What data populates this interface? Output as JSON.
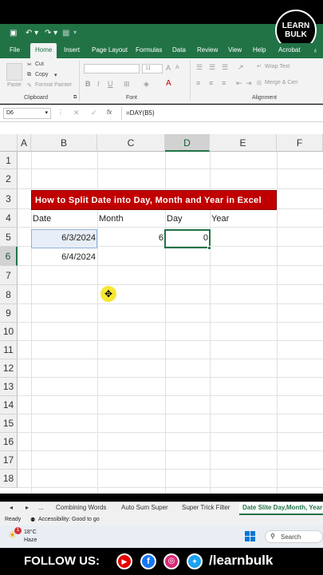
{
  "qat": {
    "save_icon": "save-icon",
    "undo_icon": "undo-icon",
    "redo_icon": "redo-icon"
  },
  "logo": {
    "line1": "LEARN",
    "line2": "BULK"
  },
  "tabs": [
    "File",
    "Home",
    "Insert",
    "Page Layout",
    "Formulas",
    "Data",
    "Review",
    "View",
    "Help",
    "Acrobat"
  ],
  "ribbon": {
    "cut": "Cut",
    "copy": "Copy",
    "format_painter": "Format Painter",
    "paste": "Paste",
    "clipboard": "Clipboard",
    "font": "Font",
    "alignment": "Alignment",
    "font_size": "11",
    "wrap_text": "Wrap Text",
    "merge_center": "Merge & Cen",
    "bold": "B",
    "italic": "I",
    "underline": "U"
  },
  "formula_bar": {
    "name_box": "D6",
    "fx": "fx",
    "formula": "=DAY(B5)"
  },
  "columns": [
    "A",
    "B",
    "C",
    "D",
    "E",
    "F"
  ],
  "rows": [
    "1",
    "2",
    "3",
    "4",
    "5",
    "6",
    "7",
    "8",
    "9",
    "10",
    "11",
    "12",
    "13",
    "14",
    "15",
    "16",
    "17",
    "18"
  ],
  "cells": {
    "title": "How to Split Date into Day, Month and Year in Excel",
    "a4": "Date",
    "c4": "Month",
    "d4": "Day",
    "e4": "Year",
    "b5": "6/3/2024",
    "c5": "6",
    "d5": "0",
    "b6": "6/4/2024"
  },
  "sheet_tabs": [
    "...",
    "Combining Words",
    "Auto Sum Super",
    "Super Trick Filter",
    "Date Slite Day,Month, Year"
  ],
  "status": {
    "ready": "Ready",
    "accessibility": "Accessibility: Good to go"
  },
  "taskbar": {
    "temp": "18°C",
    "weather": "Haze",
    "search": "Search",
    "badge": "1"
  },
  "follow": {
    "text": "FOLLOW US:",
    "handle": "/learnbulk"
  },
  "colors": {
    "excel_green": "#217346",
    "title_red": "#c00000"
  }
}
